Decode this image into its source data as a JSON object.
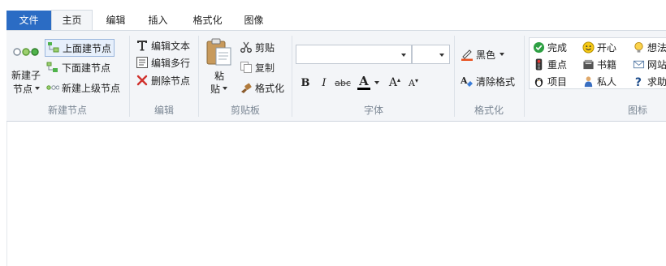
{
  "tabs": [
    {
      "label": "文件"
    },
    {
      "label": "主页"
    },
    {
      "label": "编辑"
    },
    {
      "label": "插入"
    },
    {
      "label": "格式化"
    },
    {
      "label": "图像"
    }
  ],
  "groups": {
    "new_node": {
      "label": "新建节点",
      "big_button_line1": "新建子",
      "big_button_line2": "节点",
      "items": [
        "上面建节点",
        "下面建节点",
        "新建上级节点"
      ]
    },
    "edit": {
      "label": "编辑",
      "items": [
        "编辑文本",
        "编辑多行",
        "删除节点"
      ]
    },
    "clipboard": {
      "label": "剪贴板",
      "paste_line1": "粘",
      "paste_line2": "贴",
      "items": [
        "剪贴",
        "复制",
        "格式化"
      ]
    },
    "font": {
      "label": "字体",
      "font_name": "",
      "font_size": "",
      "bold": "B",
      "italic": "I",
      "strike": "abc",
      "font_color": "A",
      "grow": "A",
      "shrink": "A"
    },
    "format": {
      "label": "格式化",
      "color_label": "黑色",
      "clear_label": "清除格式"
    },
    "icons": {
      "label": "图标",
      "col1": [
        "完成",
        "重点",
        "项目"
      ],
      "col2": [
        "开心",
        "书籍",
        "私人"
      ],
      "col3": [
        "想法",
        "网站",
        "求助"
      ]
    }
  },
  "colors": {
    "accent": "#2b6cc4",
    "ribbon_bg": "#f3f5f8",
    "group_label": "#7b8794"
  }
}
